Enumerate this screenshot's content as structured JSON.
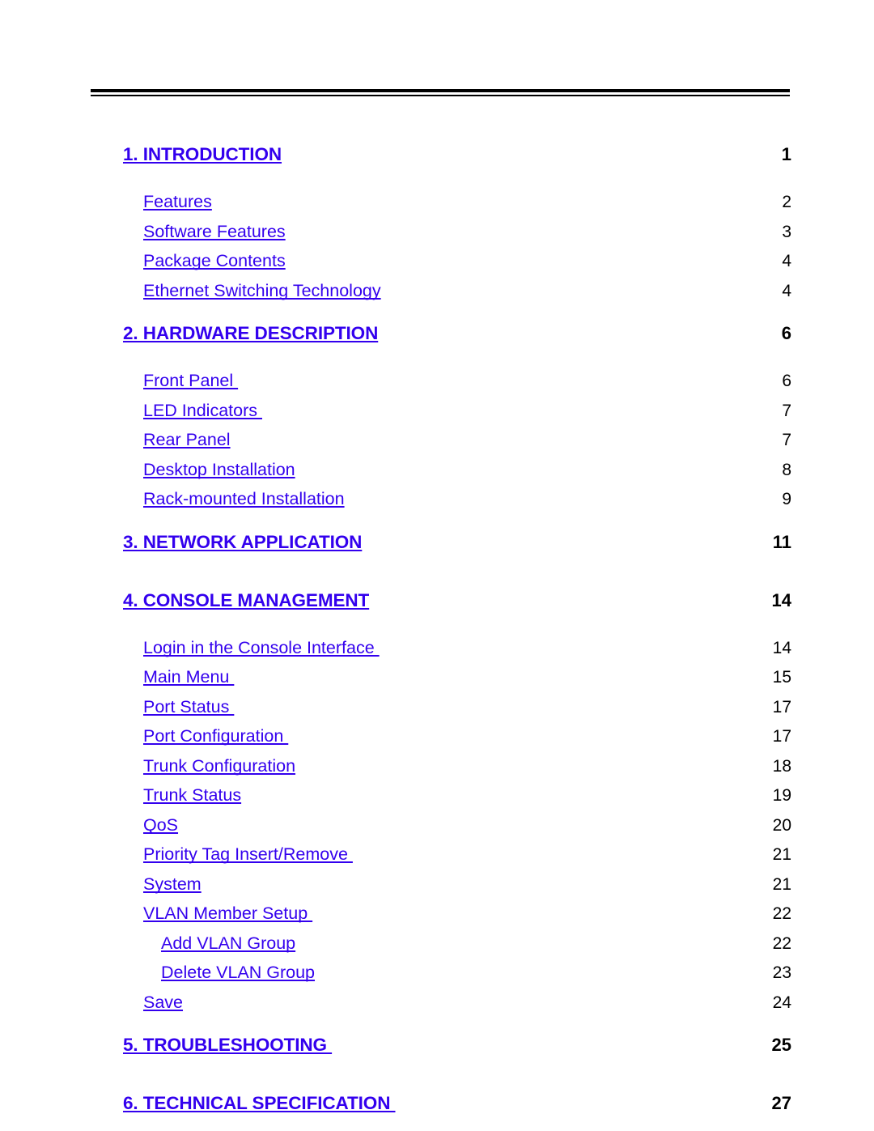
{
  "document": {
    "type": "table-of-contents",
    "colors": {
      "link": "#3300EE",
      "page_number": "#000000",
      "rule": "#000000",
      "background": "#FFFFFF"
    },
    "header_rule": "double-horizontal-rule"
  },
  "toc": {
    "entries": [
      {
        "level": 1,
        "label": "1. INTRODUCTION",
        "page": "1"
      },
      {
        "level": 2,
        "label": "Features",
        "page": "2"
      },
      {
        "level": 2,
        "label": "Software Features",
        "page": "3"
      },
      {
        "level": 2,
        "label": "Package Contents",
        "page": "4"
      },
      {
        "level": 2,
        "label": "Ethernet Switching Technology",
        "page": "4"
      },
      {
        "level": 1,
        "label": "2. HARDWARE DESCRIPTION",
        "page": "6"
      },
      {
        "level": 2,
        "label": "Front Panel ",
        "page": "6"
      },
      {
        "level": 2,
        "label": "LED Indicators ",
        "page": "7"
      },
      {
        "level": 2,
        "label": "Rear Panel",
        "page": "7"
      },
      {
        "level": 2,
        "label": "Desktop Installation",
        "page": "8"
      },
      {
        "level": 2,
        "label": "Rack-mounted Installation",
        "page": "9"
      },
      {
        "level": 1,
        "label": "3. NETWORK APPLICATION",
        "page": "11"
      },
      {
        "level": 1,
        "label": "4. CONSOLE MANAGEMENT",
        "page": "14"
      },
      {
        "level": 2,
        "label": "Login in the Console Interface ",
        "page": "14"
      },
      {
        "level": 2,
        "label": "Main Menu ",
        "page": "15"
      },
      {
        "level": 2,
        "label": "Port Status ",
        "page": "17"
      },
      {
        "level": 2,
        "label": "Port Configuration ",
        "page": "17"
      },
      {
        "level": 2,
        "label": "Trunk Configuration",
        "page": "18"
      },
      {
        "level": 2,
        "label": "Trunk Status",
        "page": "19"
      },
      {
        "level": 2,
        "label": "QoS",
        "page": "20"
      },
      {
        "level": 2,
        "label": "Priority Tag Insert/Remove ",
        "page": "21"
      },
      {
        "level": 2,
        "label": "System",
        "page": "21"
      },
      {
        "level": 2,
        "label": "VLAN Member Setup ",
        "page": "22"
      },
      {
        "level": 3,
        "label": "Add VLAN Group",
        "page": "22"
      },
      {
        "level": 3,
        "label": "Delete VLAN Group",
        "page": "23"
      },
      {
        "level": 2,
        "label": "Save",
        "page": "24"
      },
      {
        "level": 1,
        "label": "5. TROUBLESHOOTING ",
        "page": "25"
      },
      {
        "level": 1,
        "label": "6. TECHNICAL SPECIFICATION ",
        "page": "27"
      }
    ]
  }
}
